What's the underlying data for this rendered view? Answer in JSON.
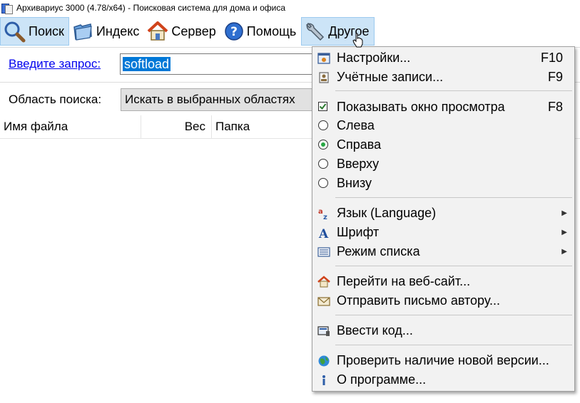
{
  "window": {
    "title": "Архивариус 3000 (4.78/x64) - Поисковая система для дома и офиса"
  },
  "toolbar": {
    "search_label": "Поиск",
    "index_label": "Индекс",
    "server_label": "Сервер",
    "help_label": "Помощь",
    "other_label": "Другое"
  },
  "query": {
    "label": "Введите запрос:",
    "value": "softload"
  },
  "area": {
    "label": "Область поиска:",
    "value": "Искать в выбранных областях"
  },
  "columns": {
    "name": "Имя файла",
    "size": "Вес",
    "folder": "Папка"
  },
  "menu": {
    "settings": {
      "label": "Настройки...",
      "shortcut": "F10"
    },
    "accounts": {
      "label": "Учётные записи...",
      "shortcut": "F9"
    },
    "preview": {
      "label": "Показывать окно просмотра",
      "shortcut": "F8",
      "checked": true
    },
    "left": {
      "label": "Слева"
    },
    "right": {
      "label": "Справа",
      "selected": true
    },
    "top": {
      "label": "Вверху"
    },
    "bottom": {
      "label": "Внизу"
    },
    "language": {
      "label": "Язык (Language)"
    },
    "font": {
      "label": "Шрифт"
    },
    "list_mode": {
      "label": "Режим списка"
    },
    "website": {
      "label": "Перейти на веб-сайт..."
    },
    "mail_author": {
      "label": "Отправить письмо автору..."
    },
    "enter_code": {
      "label": "Ввести код..."
    },
    "check_update": {
      "label": "Проверить наличие новой версии..."
    },
    "about": {
      "label": "О программе..."
    }
  },
  "colors": {
    "accent": "#0078d7",
    "toolbar_active": "#cce4f7",
    "link": "#0000ee",
    "radio_on": "#28a745",
    "check_on": "#2e7d32"
  }
}
